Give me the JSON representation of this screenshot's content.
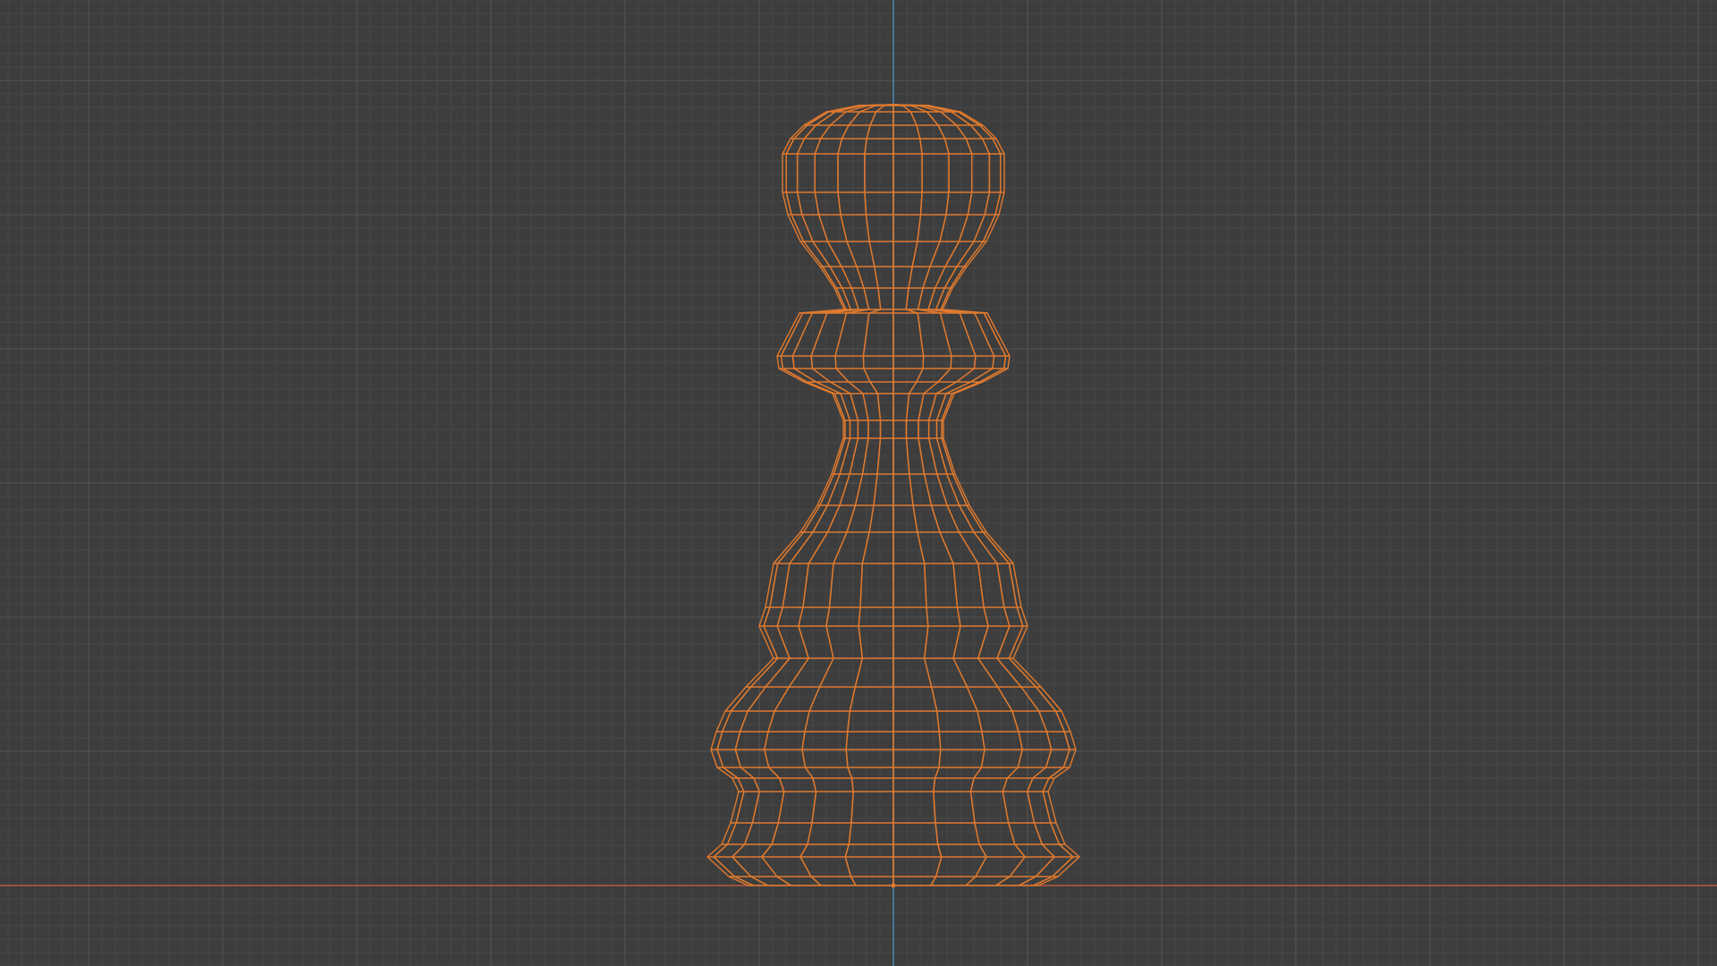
{
  "viewport": {
    "view": "front-orthographic",
    "shading": "wireframe",
    "grid_visible": true,
    "origin_axes_visible": true
  },
  "scene": {
    "object": "pawn-mesh",
    "selected": true,
    "display": "wireframe"
  },
  "colors": {
    "background": "#3d3d3d",
    "grid_minor": "#474747",
    "grid_major": "#555555",
    "x_axis": "#b75a3c",
    "z_axis": "#4f87b4",
    "selected_edge": "#e07a2e"
  },
  "icons": {
    "origin": "origin-marker-icon"
  }
}
